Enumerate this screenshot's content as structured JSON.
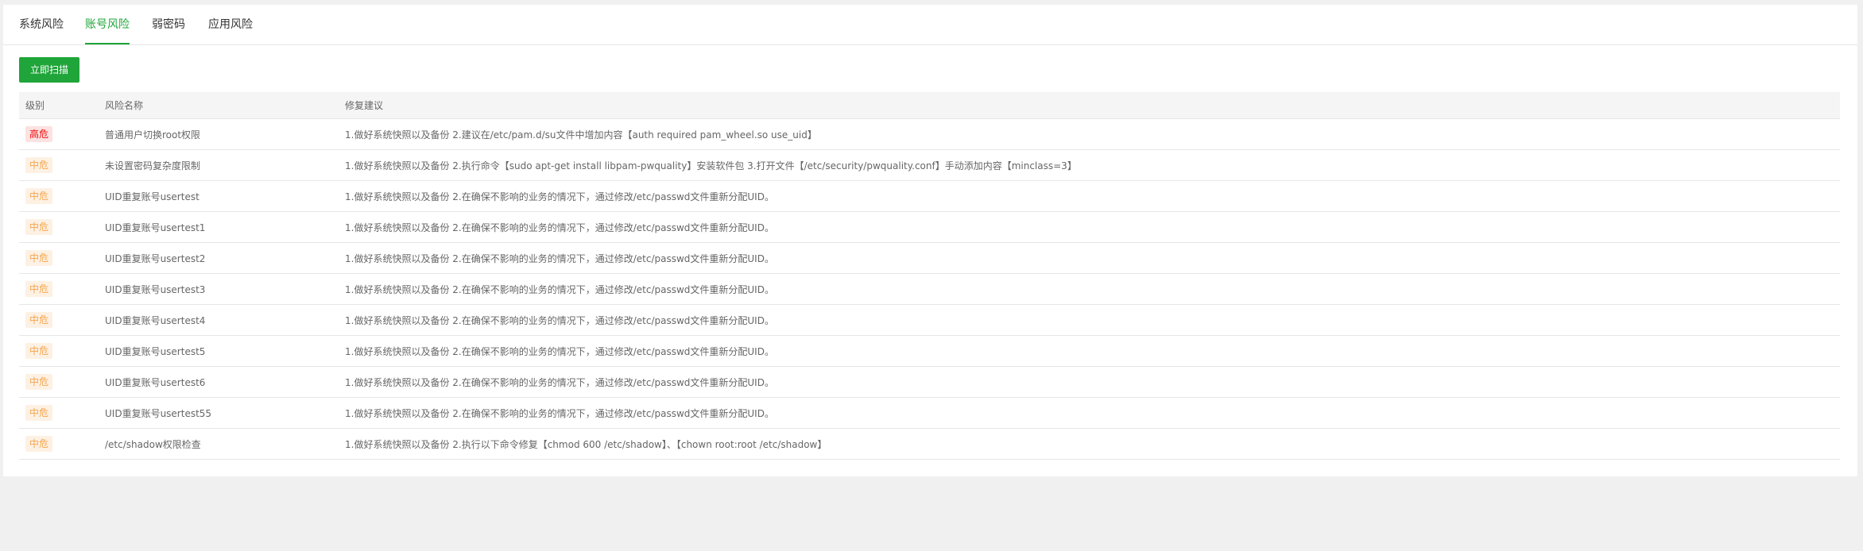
{
  "tabs": [
    {
      "label": "系统风险"
    },
    {
      "label": "账号风险"
    },
    {
      "label": "弱密码"
    },
    {
      "label": "应用风险"
    }
  ],
  "active_tab": "账号风险",
  "scan_button": "立即扫描",
  "table": {
    "headers": [
      "级别",
      "风险名称",
      "修复建议"
    ],
    "rows": [
      {
        "level": "高危",
        "name": "普通用户切换root权限",
        "advice": "1.做好系统快照以及备份 2.建议在/etc/pam.d/su文件中增加内容【auth required pam_wheel.so use_uid】"
      },
      {
        "level": "中危",
        "name": "未设置密码复杂度限制",
        "advice": "1.做好系统快照以及备份 2.执行命令【sudo apt-get install libpam-pwquality】安装软件包 3.打开文件【/etc/security/pwquality.conf】手动添加内容【minclass=3】"
      },
      {
        "level": "中危",
        "name": "UID重复账号usertest",
        "advice": "1.做好系统快照以及备份 2.在确保不影响的业务的情况下，通过修改/etc/passwd文件重新分配UID。"
      },
      {
        "level": "中危",
        "name": "UID重复账号usertest1",
        "advice": "1.做好系统快照以及备份 2.在确保不影响的业务的情况下，通过修改/etc/passwd文件重新分配UID。"
      },
      {
        "level": "中危",
        "name": "UID重复账号usertest2",
        "advice": "1.做好系统快照以及备份 2.在确保不影响的业务的情况下，通过修改/etc/passwd文件重新分配UID。"
      },
      {
        "level": "中危",
        "name": "UID重复账号usertest3",
        "advice": "1.做好系统快照以及备份 2.在确保不影响的业务的情况下，通过修改/etc/passwd文件重新分配UID。"
      },
      {
        "level": "中危",
        "name": "UID重复账号usertest4",
        "advice": "1.做好系统快照以及备份 2.在确保不影响的业务的情况下，通过修改/etc/passwd文件重新分配UID。"
      },
      {
        "level": "中危",
        "name": "UID重复账号usertest5",
        "advice": "1.做好系统快照以及备份 2.在确保不影响的业务的情况下，通过修改/etc/passwd文件重新分配UID。"
      },
      {
        "level": "中危",
        "name": "UID重复账号usertest6",
        "advice": "1.做好系统快照以及备份 2.在确保不影响的业务的情况下，通过修改/etc/passwd文件重新分配UID。"
      },
      {
        "level": "中危",
        "name": "UID重复账号usertest55",
        "advice": "1.做好系统快照以及备份 2.在确保不影响的业务的情况下，通过修改/etc/passwd文件重新分配UID。"
      },
      {
        "level": "中危",
        "name": "/etc/shadow权限检查",
        "advice": "1.做好系统快照以及备份 2.执行以下命令修复【chmod 600 /etc/shadow】、【chown root:root /etc/shadow】"
      }
    ]
  },
  "colors": {
    "accent": "#20a53a",
    "high_bg": "#fde2e2",
    "high_text": "#ef0808",
    "mid_bg": "#fdf1e4",
    "mid_text": "#f7a54c"
  }
}
